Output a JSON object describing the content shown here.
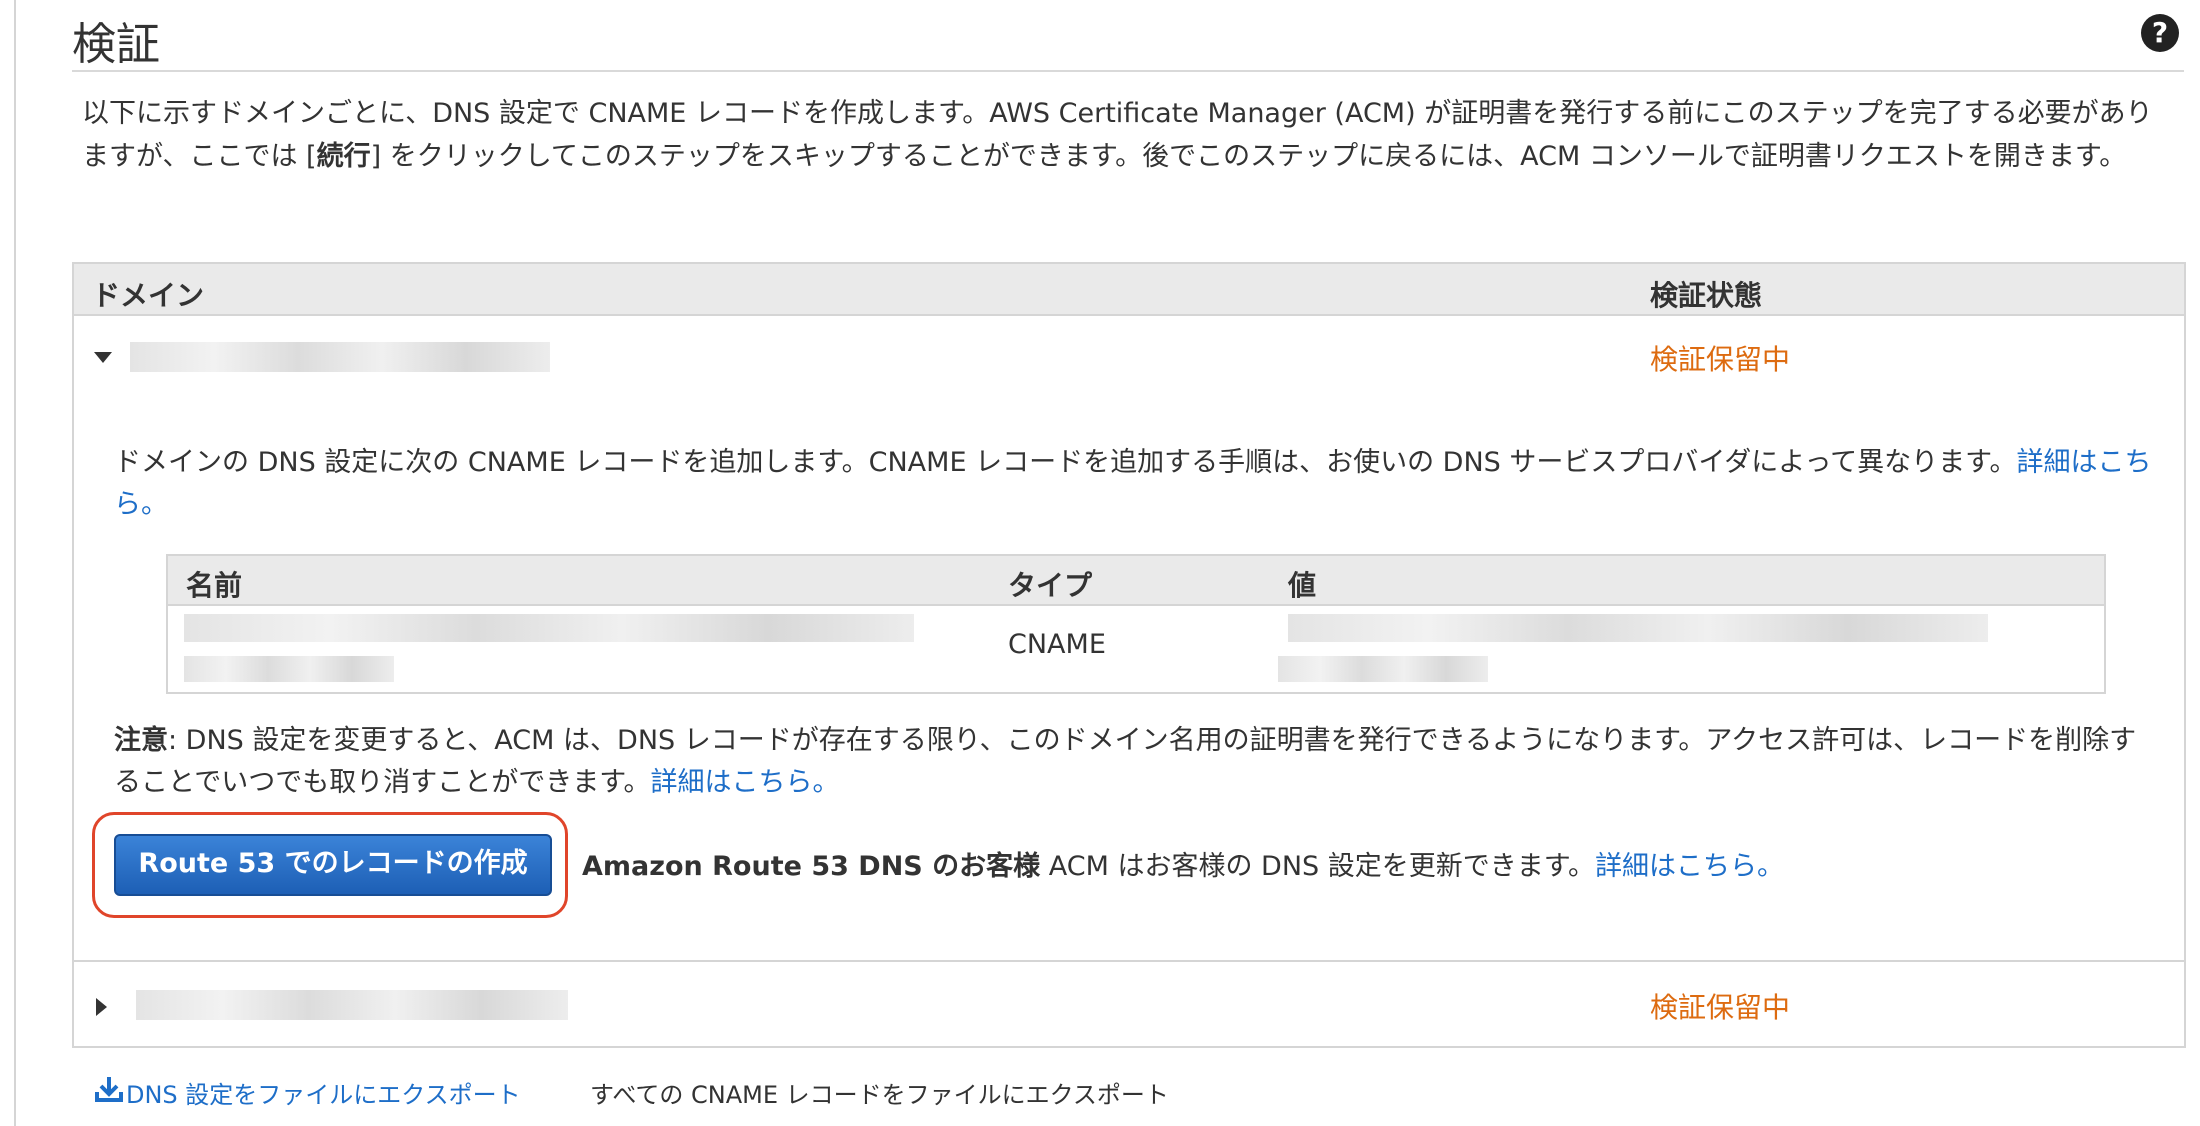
{
  "header": {
    "title": "検証",
    "help_icon": "question-circle-icon"
  },
  "intro": {
    "text_1": "以下に示すドメインごとに、DNS 設定で CNAME レコードを作成します。AWS Certificate Manager (ACM) が証明書を発行する前にこのステップを完了する必要がありますが、ここでは [",
    "bold": "続行",
    "text_2": "] をクリックしてこのステップをスキップすることができます。後でこのステップに戻るには、ACM コンソールで証明書リクエストを開きます。"
  },
  "domains_table": {
    "col_domain": "ドメイン",
    "col_status": "検証状態",
    "rows": [
      {
        "status": "検証保留中",
        "expanded": true
      },
      {
        "status": "検証保留中",
        "expanded": false
      }
    ]
  },
  "expanded": {
    "instruction": "ドメインの DNS 設定に次の CNAME レコードを追加します。CNAME レコードを追加する手順は、お使いの DNS サービスプロバイダによって異なります。",
    "instruction_link": "詳細はこちら。",
    "record_table": {
      "col_name": "名前",
      "col_type": "タイプ",
      "col_value": "値",
      "type_value": "CNAME"
    },
    "note_label": "注意",
    "note_text": ": DNS 設定を変更すると、ACM は、DNS レコードが存在する限り、このドメイン名用の証明書を発行できるようになります。アクセス許可は、レコードを削除することでいつでも取り消すことができます。",
    "note_link": "詳細はこちら。",
    "route53_button": "Route 53 でのレコードの作成",
    "route53_bold": "Amazon Route 53 DNS のお客様",
    "route53_text": " ACM はお客様の DNS 設定を更新できます。",
    "route53_link": "詳細はこちら。"
  },
  "footer": {
    "export_link": "DNS 設定をファイルにエクスポート",
    "export_desc": "すべての CNAME レコードをファイルにエクスポート",
    "export_icon": "download-icon"
  },
  "colors": {
    "link": "#1e6ec8",
    "pending": "#dd6b10",
    "button": "#1d5fb5",
    "highlight": "#e0452a"
  }
}
